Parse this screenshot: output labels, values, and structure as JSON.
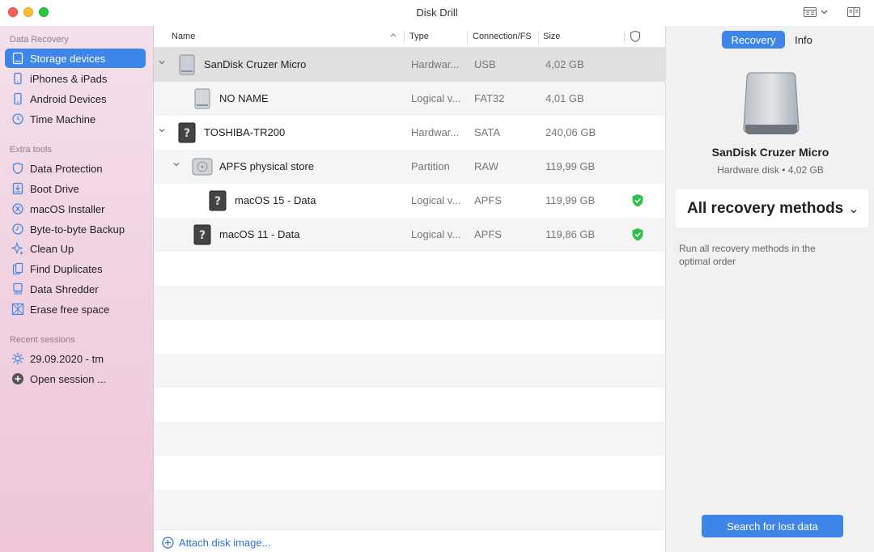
{
  "app": {
    "title": "Disk Drill"
  },
  "sidebar": {
    "sections": [
      {
        "label": "Data Recovery"
      },
      {
        "label": "Extra tools"
      },
      {
        "label": "Recent sessions"
      }
    ],
    "recovery_items": [
      {
        "label": "Storage devices",
        "icon": "drive-icon"
      },
      {
        "label": "iPhones & iPads",
        "icon": "phone-icon"
      },
      {
        "label": "Android Devices",
        "icon": "phone-icon"
      },
      {
        "label": "Time Machine",
        "icon": "clock-icon"
      }
    ],
    "tool_items": [
      {
        "label": "Data Protection",
        "icon": "shield-icon"
      },
      {
        "label": "Boot Drive",
        "icon": "download-icon"
      },
      {
        "label": "macOS Installer",
        "icon": "x-circle-icon"
      },
      {
        "label": "Byte-to-byte Backup",
        "icon": "clock-icon"
      },
      {
        "label": "Clean Up",
        "icon": "sparkle-icon"
      },
      {
        "label": "Find Duplicates",
        "icon": "document-icon"
      },
      {
        "label": "Data Shredder",
        "icon": "document-icon"
      },
      {
        "label": "Erase free space",
        "icon": "grid-icon"
      }
    ],
    "session_items": [
      {
        "label": "29.09.2020 - tm",
        "icon": "gear-icon"
      },
      {
        "label": "Open session ...",
        "icon": "plus-circle-icon"
      }
    ]
  },
  "table": {
    "columns": {
      "name": "Name",
      "type": "Type",
      "connection": "Connection/FS",
      "size": "Size"
    },
    "rows": [
      {
        "name": "SanDisk Cruzer Micro",
        "type": "Hardwar...",
        "conn": "USB",
        "size": "4,02 GB",
        "protected": false
      },
      {
        "name": "NO NAME",
        "type": "Logical v...",
        "conn": "FAT32",
        "size": "4,01 GB",
        "protected": false
      },
      {
        "name": "TOSHIBA-TR200",
        "type": "Hardwar...",
        "conn": "SATA",
        "size": "240,06 GB",
        "protected": false
      },
      {
        "name": "APFS physical store",
        "type": "Partition",
        "conn": "RAW",
        "size": "119,99 GB",
        "protected": false
      },
      {
        "name": "macOS 15 - Data",
        "type": "Logical v...",
        "conn": "APFS",
        "size": "119,99 GB",
        "protected": true
      },
      {
        "name": "macOS 11 - Data",
        "type": "Logical v...",
        "conn": "APFS",
        "size": "119,86 GB",
        "protected": true
      }
    ],
    "attach_label": "Attach disk image..."
  },
  "panel": {
    "tabs": [
      "Recovery",
      "Info"
    ],
    "disk_name": "SanDisk Cruzer Micro",
    "disk_sub": "Hardware disk • 4,02 GB",
    "method": "All recovery methods",
    "description": "Run all recovery methods in the optimal order",
    "search_button": "Search for lost data"
  },
  "colors": {
    "accent": "#3d86e8",
    "protect_green": "#2fbf4b"
  }
}
